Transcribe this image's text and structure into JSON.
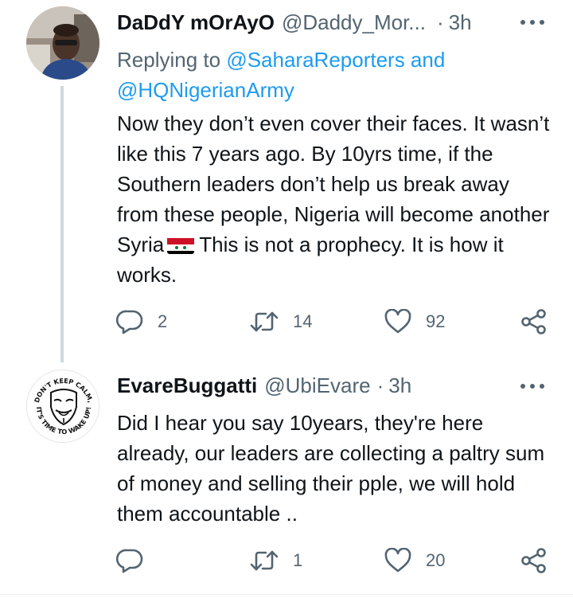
{
  "tweets": [
    {
      "display_name": "DaDdY mOrAyO",
      "handle": "@Daddy_Mor...",
      "separator": "·",
      "time": "3h",
      "replying_prefix": "Replying to ",
      "replying_mention_1": "@SaharaReporters",
      "replying_and": " and ",
      "replying_mention_2": "@HQNigerianArmy",
      "text_before_flag": "Now they don’t even cover their faces. It wasn’t like this 7 years ago. By 10yrs time, if the Southern leaders don’t help us break away from these people, Nigeria will become another Syria",
      "text_after_flag": "This is not a prophecy. It is how it works.",
      "flag_icon": "syria-flag-icon",
      "reply_count": "2",
      "retweet_count": "14",
      "like_count": "92"
    },
    {
      "display_name": "EvareBuggatti",
      "handle": "@UbiEvare",
      "separator": "·",
      "time": "3h",
      "text": "Did I hear you say 10years, they're here already,  our  leaders are collecting a paltry sum of money and selling their pple, we will hold them accountable ..",
      "avatar_text_top": "DON'T KEEP CALM,",
      "avatar_text_bottom": "IT'S TIME TO WAKE UP!",
      "reply_count": "",
      "retweet_count": "1",
      "like_count": "20"
    }
  ],
  "icons": {
    "reply": "reply-icon",
    "retweet": "retweet-icon",
    "like": "heart-icon",
    "share": "share-icon",
    "more": "more-icon"
  },
  "colors": {
    "text": "#0f1419",
    "secondary": "#536471",
    "link": "#1d9bf0",
    "thread_line": "#cfd9de"
  }
}
